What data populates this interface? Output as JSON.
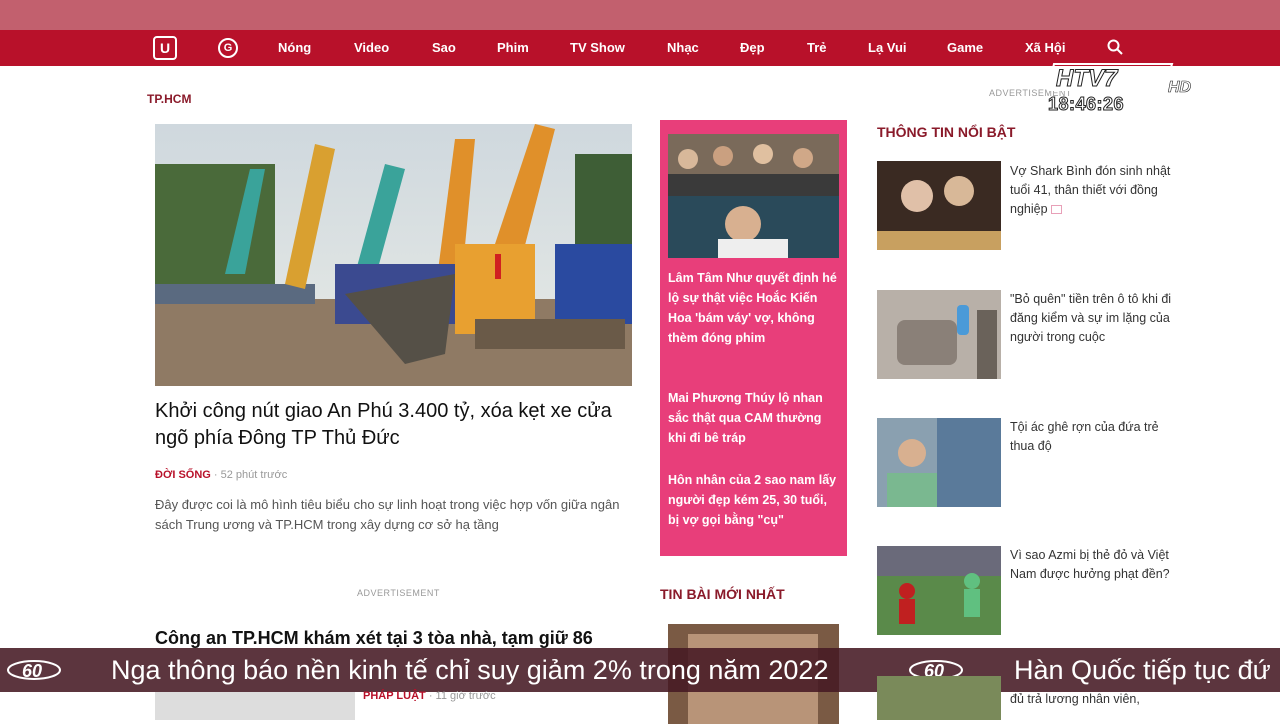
{
  "nav": {
    "logo_glyph": "U",
    "icon2_glyph": "G",
    "items": [
      "Nóng",
      "Video",
      "Sao",
      "Phim",
      "TV Show",
      "Nhạc",
      "Đẹp",
      "Trẻ",
      "Lạ Vui",
      "Game",
      "Xã Hội"
    ]
  },
  "main": {
    "section": "TP.HCM",
    "hero": {
      "title": "Khởi công nút giao An Phú 3.400 tỷ, xóa kẹt xe cửa ngõ phía Đông TP Thủ Đức",
      "category": "ĐỜI SỐNG",
      "time": "52 phút trước",
      "description": "Đây được coi là mô hình tiêu biểu cho sự linh hoạt trong việc hợp vốn giữa ngân sách Trung ương và TP.HCM trong xây dựng cơ sở hạ tầng"
    },
    "ad_label": "ADVERTISEMENT",
    "story2": {
      "title": "Công an TP.HCM khám xét tại 3 tòa nhà, tạm giữ 86",
      "category": "PHÁP LUẬT",
      "time": "11 giờ trước"
    }
  },
  "pink": {
    "items": [
      "Lâm Tâm Như quyết định hé lộ sự thật việc Hoắc Kiến Hoa 'bám váy' vợ, không thèm đóng phim",
      "Mai Phương Thúy lộ nhan sắc thật qua CAM thường khi đi bê tráp",
      "Hôn nhân của 2 sao nam lấy người đẹp kém 25, 30 tuổi, bị vợ gọi bằng \"cụ\""
    ]
  },
  "latest": {
    "title": "TIN BÀI MỚI NHẤT"
  },
  "right": {
    "ad_label": "ADVERTISEMENT",
    "title": "THÔNG TIN NỔI BẬT",
    "items": [
      "Vợ Shark Bình đón sinh nhật tuổi 41, thân thiết với đồng nghiệp",
      "\"Bỏ quên\" tiền trên ô tô khi đi đăng kiểm và sự im lặng của người trong cuộc",
      "Tội ác ghê rợn của đứa trẻ thua độ",
      "Vì sao Azmi bị thẻ đỏ và Việt Nam được hưởng phạt đền?"
    ],
    "bottom_text": "đủ trả lương nhân viên,"
  },
  "overlay": {
    "channel": "HTV7",
    "channel_suffix": "HD",
    "clock": "18:46:26",
    "ticker_logo": "60",
    "ticker_items": [
      "Nga thông báo nền kinh tế chỉ suy giảm 2% trong năm 2022",
      "Hàn Quốc tiếp tục đứ"
    ]
  },
  "colors": {
    "nav_bg": "#b8112a",
    "pink_box": "#e83e7a",
    "heading": "#8a1a2a",
    "ticker_bg": "#46192300"
  }
}
